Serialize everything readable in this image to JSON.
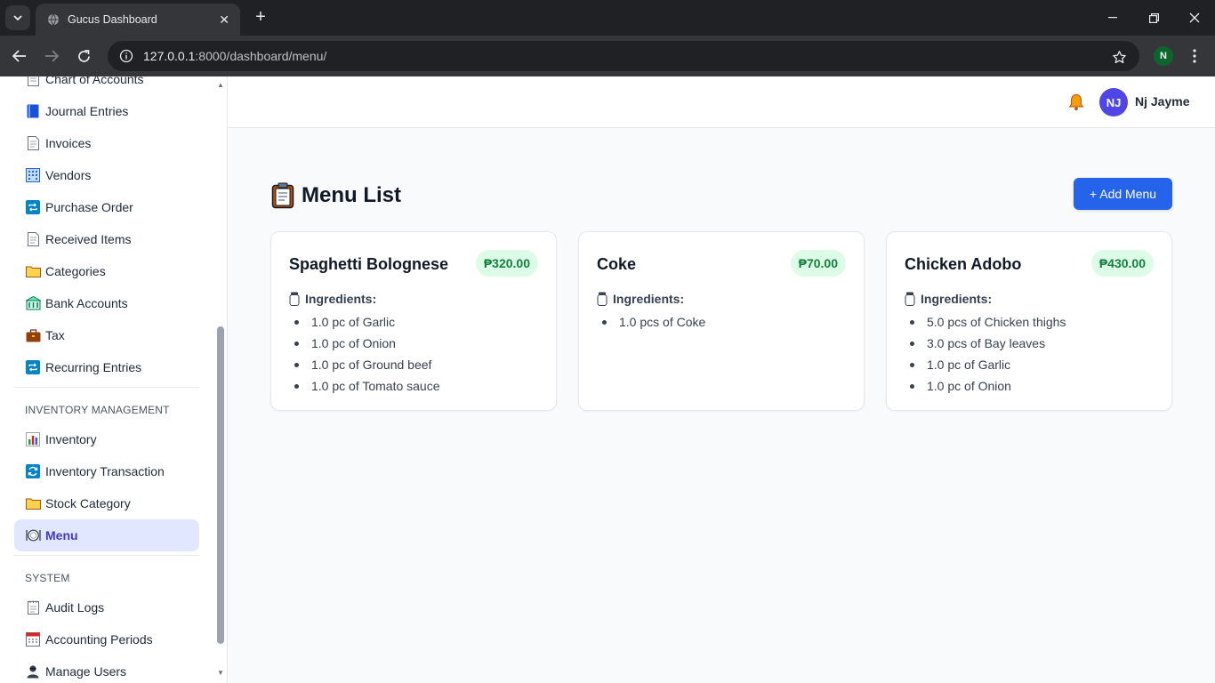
{
  "browser": {
    "tab_title": "Gucus Dashboard",
    "url_host": "127.0.0.1",
    "url_path": ":8000/dashboard/menu/",
    "profile_initial": "N"
  },
  "sidebar": {
    "items_top": [
      {
        "label": "Chart of Accounts",
        "icon": "ledger-icon"
      },
      {
        "label": "Journal Entries",
        "icon": "blue-book-icon"
      },
      {
        "label": "Invoices",
        "icon": "page-icon"
      },
      {
        "label": "Vendors",
        "icon": "building-icon"
      },
      {
        "label": "Purchase Order",
        "icon": "repeat-icon"
      },
      {
        "label": "Received Items",
        "icon": "page-icon"
      },
      {
        "label": "Categories",
        "icon": "folder-icon"
      },
      {
        "label": "Bank Accounts",
        "icon": "bank-icon"
      },
      {
        "label": "Tax",
        "icon": "briefcase-icon"
      },
      {
        "label": "Recurring Entries",
        "icon": "repeat-icon"
      }
    ],
    "section_inventory": "INVENTORY MANAGEMENT",
    "items_inventory": [
      {
        "label": "Inventory",
        "icon": "bar-chart-icon"
      },
      {
        "label": "Inventory Transaction",
        "icon": "arrows-cycle-icon"
      },
      {
        "label": "Stock Category",
        "icon": "folder-icon"
      },
      {
        "label": "Menu",
        "icon": "plate-icon",
        "active": true
      }
    ],
    "section_system": "SYSTEM",
    "items_system": [
      {
        "label": "Audit Logs",
        "icon": "notepad-icon"
      },
      {
        "label": "Accounting Periods",
        "icon": "calendar-icon"
      },
      {
        "label": "Manage Users",
        "icon": "user-icon"
      }
    ]
  },
  "header": {
    "avatar_initials": "NJ",
    "user_name": "Nj Jayme",
    "colors": {
      "avatar": "#4f46e5"
    }
  },
  "main": {
    "title": "Menu List",
    "add_button": "+ Add Menu",
    "ingredients_label": "Ingredients:",
    "colors": {
      "accent": "#2563eb",
      "price_bg": "#dcfce7",
      "price_text": "#15803d"
    },
    "cards": [
      {
        "name": "Spaghetti Bolognese",
        "price": "₱320.00",
        "ingredients": [
          "1.0 pc of Garlic",
          "1.0 pc of Onion",
          "1.0 pc of Ground beef",
          "1.0 pc of Tomato sauce"
        ]
      },
      {
        "name": "Coke",
        "price": "₱70.00",
        "ingredients": [
          "1.0 pcs of Coke"
        ]
      },
      {
        "name": "Chicken Adobo",
        "price": "₱430.00",
        "ingredients": [
          "5.0 pcs of Chicken thighs",
          "3.0 pcs of Bay leaves",
          "1.0 pc of Garlic",
          "1.0 pc of Onion"
        ]
      }
    ]
  }
}
